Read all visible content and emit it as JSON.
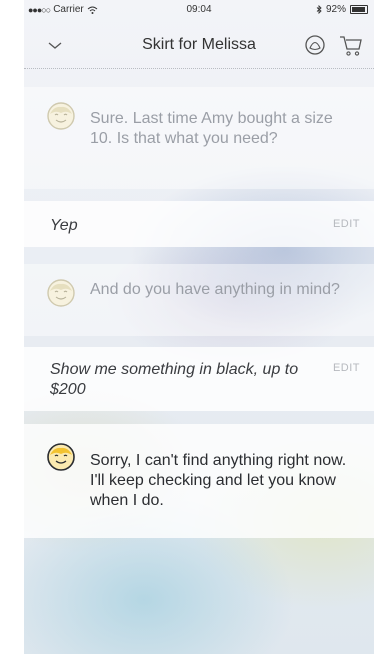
{
  "status_bar": {
    "carrier": "Carrier",
    "time": "09:04",
    "battery": "92%",
    "battery_level": 0.92
  },
  "nav": {
    "title": "Skirt for Melissa",
    "left_icon": "chevron-down-icon",
    "right_icons": [
      "support-icon",
      "cart-icon"
    ]
  },
  "messages": [
    {
      "from": "bot",
      "text": "Sure. Last time Amy bought a size 10. Is that what you need?"
    },
    {
      "from": "user",
      "text": "Yep",
      "action": "EDIT"
    },
    {
      "from": "bot",
      "text": "And do you have anything in mind?"
    },
    {
      "from": "user",
      "text": "Show me something in black, up to $200",
      "action": "EDIT"
    },
    {
      "from": "bot",
      "text": "Sorry, I can't find anything right now. I'll keep checking and let you know when I do."
    }
  ]
}
